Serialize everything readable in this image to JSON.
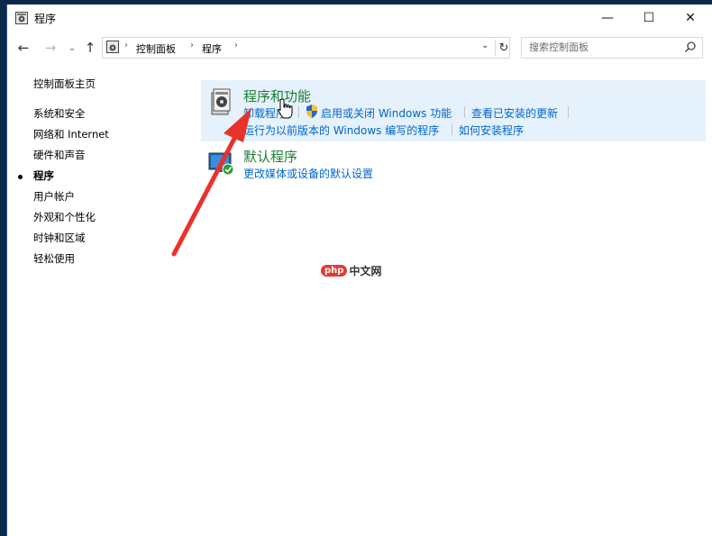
{
  "window": {
    "title": "程序",
    "controls": {
      "minimize": "—",
      "maximize": "☐",
      "close": "✕"
    }
  },
  "address_bar": {
    "back": "←",
    "forward": "→",
    "history": "⌄",
    "up": "↑",
    "breadcrumbs": [
      "控制面板",
      "程序"
    ],
    "separator": "›",
    "dropdown": "⌄",
    "refresh": "↻",
    "search_placeholder": "搜索控制面板"
  },
  "sidebar": {
    "home": "控制面板主页",
    "items": [
      {
        "label": "系统和安全",
        "active": false
      },
      {
        "label": "网络和 Internet",
        "active": false
      },
      {
        "label": "硬件和声音",
        "active": false
      },
      {
        "label": "程序",
        "active": true
      },
      {
        "label": "用户帐户",
        "active": false
      },
      {
        "label": "外观和个性化",
        "active": false
      },
      {
        "label": "时钟和区域",
        "active": false
      },
      {
        "label": "轻松使用",
        "active": false
      }
    ]
  },
  "categories": [
    {
      "title": "程序和功能",
      "links_row1": [
        "卸载程序",
        "启用或关闭 Windows 功能",
        "查看已安装的更新"
      ],
      "links_row2": [
        "运行为以前版本的 Windows 编写的程序",
        "如何安装程序"
      ]
    },
    {
      "title": "默认程序",
      "links_row1": [
        "更改媒体或设备的默认设置"
      ]
    }
  ],
  "watermark": {
    "brand": "php",
    "text": "中文网"
  },
  "colors": {
    "accent_green": "#1e7e34",
    "link_blue": "#0066cc",
    "highlight": "#e5f1fb",
    "arrow_red": "#e8322a"
  }
}
